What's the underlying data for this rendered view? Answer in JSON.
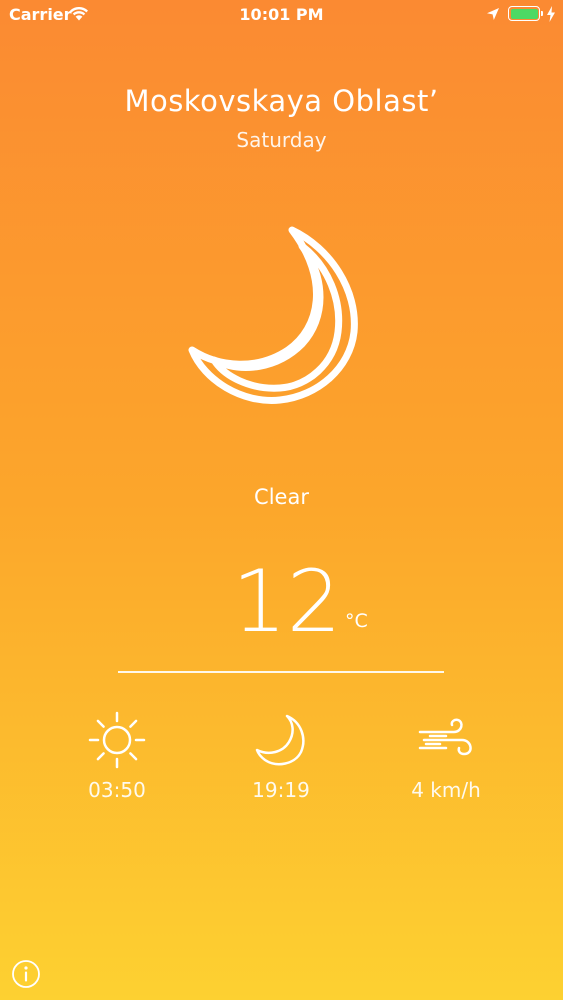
{
  "status_bar": {
    "carrier": "Carrier",
    "time": "10:01 PM",
    "battery_color": "#4cd964"
  },
  "weather": {
    "location": "Moskovskaya Oblast’",
    "day": "Saturday",
    "icon": "moon-icon",
    "condition": "Clear",
    "temperature": "12",
    "unit": "°C"
  },
  "details": {
    "sunrise": {
      "icon": "sun-icon",
      "value": "03:50"
    },
    "sunset": {
      "icon": "moon-icon",
      "value": "19:19"
    },
    "wind": {
      "icon": "wind-icon",
      "value": "4 km/h"
    }
  },
  "footer": {
    "info_icon": "info-icon"
  },
  "colors": {
    "gradient_top": "#fb8a32",
    "gradient_bottom": "#fdd131",
    "foreground": "#ffffff"
  }
}
